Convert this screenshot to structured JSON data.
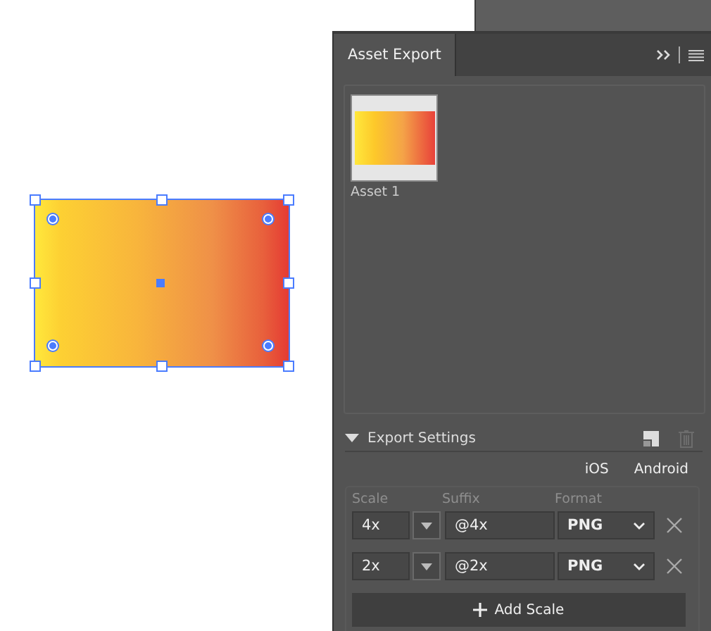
{
  "canvas": {
    "shape": {
      "kind": "picture",
      "selected": true
    }
  },
  "panel": {
    "tabs": [
      {
        "label": "Asset Export",
        "selected": true
      }
    ],
    "assets": [
      {
        "label": "Asset 1",
        "selected": false
      }
    ],
    "export_settings": {
      "title": "Export Settings",
      "expanded": true,
      "platforms": [
        {
          "label": "iOS"
        },
        {
          "label": "Android"
        }
      ],
      "columns": [
        "Scale",
        "Suffix",
        "Format"
      ],
      "scales": [
        {
          "scale": "4x",
          "suffix": "@4x",
          "format": "PNG"
        },
        {
          "scale": "2x",
          "suffix": "@2x",
          "format": "PNG"
        }
      ],
      "add_button": "Add Scale"
    }
  }
}
